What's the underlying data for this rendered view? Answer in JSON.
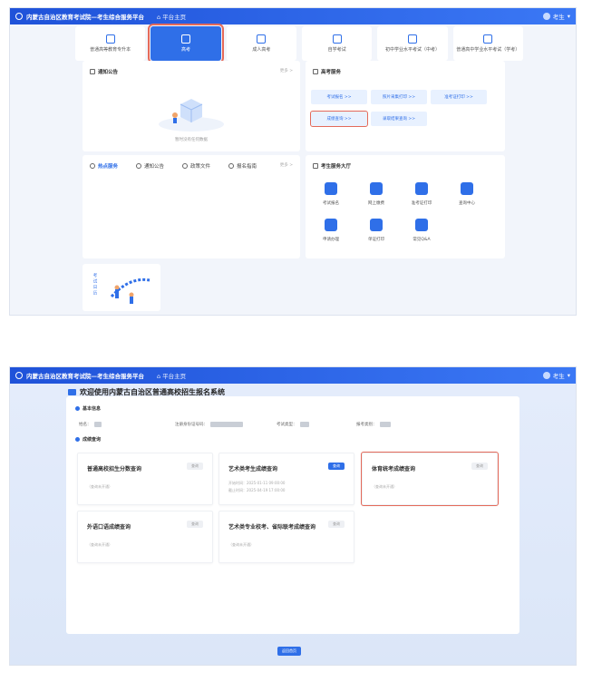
{
  "platform": {
    "title": "内蒙古自治区教育考试院—考生综合服务平台",
    "home": "平台主页",
    "user": "考生"
  },
  "shot1": {
    "nav": [
      {
        "label": "普通高等教育专升本",
        "active": false
      },
      {
        "label": "高考",
        "active": true
      },
      {
        "label": "成人高考",
        "active": false
      },
      {
        "label": "自学考试",
        "active": false
      },
      {
        "label": "初中学业水平考试（中考）",
        "active": false
      },
      {
        "label": "普通高中学业水平考试（学考）",
        "active": false
      }
    ],
    "notice": {
      "title": "通知公告",
      "more": "更多 >",
      "empty": "暂时没有任何数据"
    },
    "hot_tabs": [
      {
        "label": "热点服务",
        "active": true
      },
      {
        "label": "通知公告",
        "active": false
      },
      {
        "label": "政策文件",
        "active": false
      },
      {
        "label": "报名指南",
        "active": false
      }
    ],
    "hot_more": "更多 >",
    "services": {
      "title": "高考服务",
      "items": [
        {
          "label": "考试报名 >>",
          "highlight": false
        },
        {
          "label": "照片采集打印 >>",
          "highlight": false
        },
        {
          "label": "准考证打印 >>",
          "highlight": false
        },
        {
          "label": "成绩查询 >>",
          "highlight": true
        },
        {
          "label": "录取结果查询 >>",
          "highlight": false
        }
      ]
    },
    "hall": {
      "title": "考生服务大厅",
      "items": [
        "考试报名",
        "网上缴费",
        "准考证打印",
        "查询中心",
        "申请办理",
        "单证打印",
        "常见Q&A"
      ]
    },
    "calendar": "考试日历"
  },
  "shot2": {
    "page_title": "欢迎使用内蒙古自治区普通高校招生报名系统",
    "basic_info": {
      "title": "基本信息",
      "fields": [
        {
          "label": "姓名："
        },
        {
          "label": "注册身份证号码："
        },
        {
          "label": "考试类型："
        },
        {
          "label": "报考类别："
        }
      ]
    },
    "score": {
      "title": "成绩查询",
      "cards": [
        {
          "title": "普通高校招生分数查询",
          "btn": "查询",
          "sub": "（查询未开通）",
          "active": false,
          "highlight": false
        },
        {
          "title": "艺术类考生成绩查询",
          "btn": "查询",
          "sub1": "开始时间：2025-01-11 09:00:00",
          "sub2": "截止时间：2025-04-19 17:00:00",
          "active": true,
          "highlight": false
        },
        {
          "title": "体育统考成绩查询",
          "btn": "查询",
          "sub": "（查询未开通）",
          "active": false,
          "highlight": true
        },
        {
          "title": "外语口语成绩查询",
          "btn": "查询",
          "sub": "（查询未开通）",
          "active": false,
          "highlight": false
        },
        {
          "title": "艺术类专业校考、省际联考成绩查询",
          "btn": "查询",
          "sub": "（查询未开通）",
          "active": false,
          "highlight": false
        }
      ]
    },
    "submit": "返回首页"
  }
}
